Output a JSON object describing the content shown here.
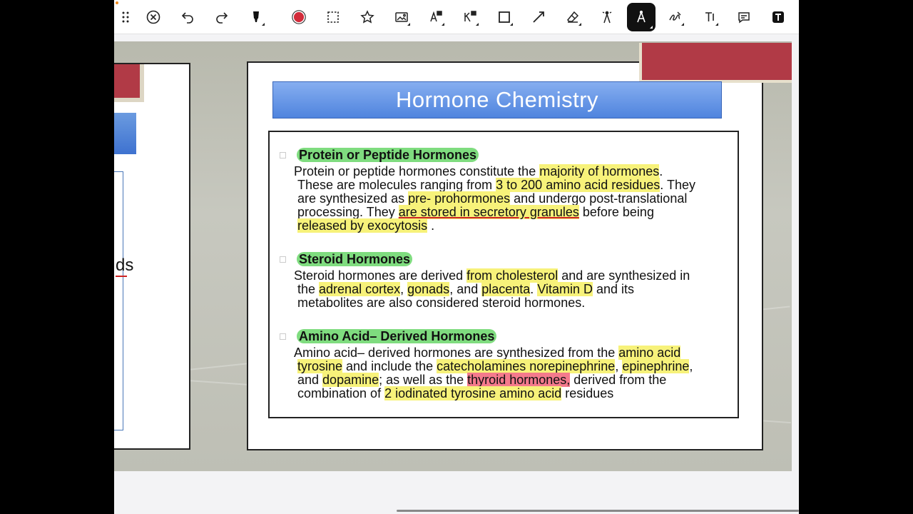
{
  "toolbar": {
    "tools": [
      {
        "icon": "drag-handle-icon"
      },
      {
        "icon": "close-circle-icon"
      },
      {
        "icon": "undo-icon"
      },
      {
        "icon": "redo-icon"
      },
      {
        "icon": "highlighter-pen-icon"
      },
      {
        "icon": "color-picker-icon",
        "color": "#d22b3a"
      },
      {
        "icon": "lasso-select-icon"
      },
      {
        "icon": "star-icon"
      },
      {
        "icon": "image-icon"
      },
      {
        "icon": "text-recognition-icon"
      },
      {
        "icon": "keyboard-shortcut-icon"
      },
      {
        "icon": "rectangle-shape-icon"
      },
      {
        "icon": "line-arrow-icon"
      },
      {
        "icon": "eraser-icon"
      },
      {
        "icon": "laser-pointer-icon"
      },
      {
        "icon": "compass-tool-icon",
        "active": true
      },
      {
        "icon": "handwriting-icon"
      },
      {
        "icon": "text-tool-icon"
      },
      {
        "icon": "comment-icon"
      },
      {
        "icon": "text-box-icon"
      }
    ]
  },
  "prev_slide": {
    "fragment_text": "ds"
  },
  "slide": {
    "title": "Hormone Chemistry",
    "sections": [
      {
        "heading": "Protein or Peptide Hormones",
        "lines": [
          [
            {
              "t": "Protein or peptide hormones constitute the "
            },
            {
              "t": "majority of hormones",
              "y": 1
            },
            {
              "t": "."
            }
          ],
          [
            {
              "t": "These are molecules ranging from "
            },
            {
              "t": "3 to 200 amino acid residues",
              "y": 1
            },
            {
              "t": ". They"
            }
          ],
          [
            {
              "t": "are synthesized as "
            },
            {
              "t": "pre- prohormones",
              "y": 1
            },
            {
              "t": " and undergo post-translational"
            }
          ],
          [
            {
              "t": "processing. They "
            },
            {
              "t": "are stored in secretory granules",
              "y": 1,
              "u": 1
            },
            {
              "t": " before being"
            }
          ],
          [
            {
              "t": "released by exocytosis",
              "y": 1
            },
            {
              "t": " ."
            }
          ]
        ]
      },
      {
        "heading": "Steroid Hormones",
        "lines": [
          [
            {
              "t": "Steroid hormones are derived "
            },
            {
              "t": "from cholesterol",
              "y": 1
            },
            {
              "t": " and are synthesized in"
            }
          ],
          [
            {
              "t": "the "
            },
            {
              "t": "adrenal cortex",
              "y": 1
            },
            {
              "t": ", "
            },
            {
              "t": "gonads",
              "y": 1
            },
            {
              "t": ", and "
            },
            {
              "t": "placenta",
              "y": 1
            },
            {
              "t": ". "
            },
            {
              "t": "Vitamin D",
              "y": 1
            },
            {
              "t": " and its"
            }
          ],
          [
            {
              "t": "metabolites are also considered steroid hormones."
            }
          ]
        ]
      },
      {
        "heading": "Amino Acid–  Derived Hormones",
        "lines": [
          [
            {
              "t": "Amino acid–  derived hormones are synthesized from the "
            },
            {
              "t": "amino acid",
              "y": 1
            }
          ],
          [
            {
              "t": "tyrosine",
              "y": 1
            },
            {
              "t": " and include the "
            },
            {
              "t": "catecholamines norepinephrine",
              "y": 1
            },
            {
              "t": ", "
            },
            {
              "t": "epinephrine",
              "y": 1
            },
            {
              "t": ","
            }
          ],
          [
            {
              "t": "and "
            },
            {
              "t": "dopamine",
              "y": 1
            },
            {
              "t": "; as well as the "
            },
            {
              "t": "thyroid hormones,",
              "p": 1
            },
            {
              "t": " derived from the"
            }
          ],
          [
            {
              "t": "combination of "
            },
            {
              "t": "2 iodinated tyrosine amino acid",
              "y": 1
            },
            {
              "t": " residues"
            }
          ]
        ]
      }
    ]
  },
  "colors": {
    "highlight_yellow": "#f7f27a",
    "highlight_green": "#7fdc7f",
    "highlight_pink": "#f47a8c",
    "slide_red": "#b13a46",
    "title_blue": "#4f84de"
  }
}
